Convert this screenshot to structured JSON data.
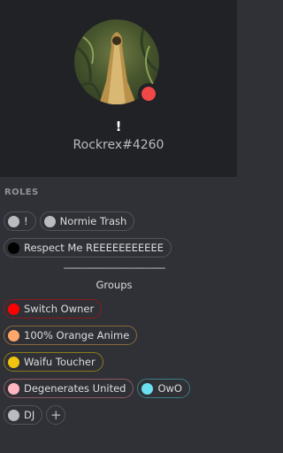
{
  "profile": {
    "username": "!",
    "tag": "Rockrex#4260",
    "status_color": "#f04747",
    "avatar_icon": "avatar-image"
  },
  "roles_section": {
    "title": "ROLES",
    "roles": [
      {
        "label": "!",
        "color": "#b9bbbe"
      },
      {
        "label": "Normie Trash",
        "color": "#b9bbbe"
      },
      {
        "label": "Respect Me REEEEEEEEEEE",
        "color": "#000000"
      }
    ],
    "divider": "--------------------------------------------",
    "groups_heading": "Groups",
    "groups": [
      {
        "label": "Switch Owner",
        "color": "#ff0000",
        "border": "#8b1a1a"
      },
      {
        "label": "100% Orange Anime",
        "color": "#ffa76a",
        "border": "#8a6a3a"
      },
      {
        "label": "Waifu Toucher",
        "color": "#f1c40f",
        "border": "#8a7a1e"
      },
      {
        "label": "Degenerates United",
        "color": "#ffb6c1",
        "border": "#8a5a63"
      },
      {
        "label": "OwO",
        "color": "#6be0f0",
        "border": "#3b7d86"
      },
      {
        "label": "DJ",
        "color": "#b9bbbe",
        "border": "#4f545c"
      }
    ],
    "add_role_label": "+"
  }
}
